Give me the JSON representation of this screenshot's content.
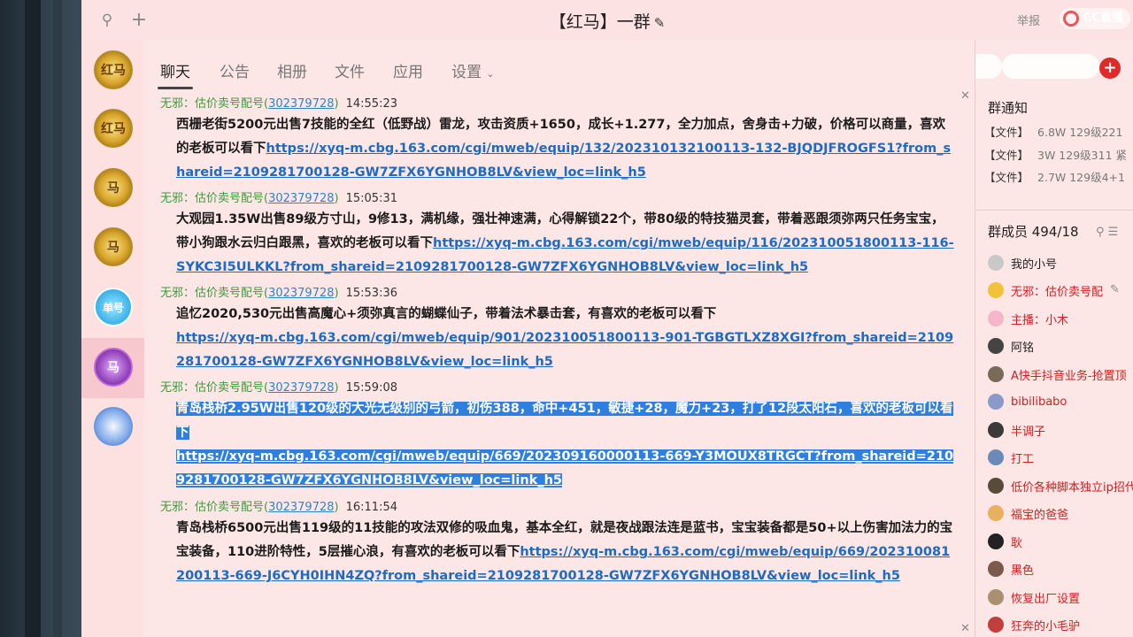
{
  "window": {
    "title": "【红马】一群",
    "report_label": "举报",
    "cc_logo_text": "CC直播"
  },
  "colors": {
    "window_bg": "#fce4e4",
    "link": "#1e6bbf",
    "sender": "#3b9b3b",
    "qq_number": "#2e86c1",
    "selection": "#2f7fe0",
    "member_highlight": "#d02020"
  },
  "sidebar": {
    "avatars": [
      {
        "label": "红马",
        "style": "gold"
      },
      {
        "label": "红马",
        "style": "gold"
      },
      {
        "label": "马",
        "style": "gold"
      },
      {
        "label": "马",
        "style": "gold"
      },
      {
        "label": "单号",
        "style": "blue"
      },
      {
        "label": "马",
        "style": "purple",
        "active": true
      },
      {
        "label": "",
        "style": "char"
      }
    ]
  },
  "tabs": [
    {
      "label": "聊天",
      "active": true
    },
    {
      "label": "公告"
    },
    {
      "label": "相册"
    },
    {
      "label": "文件"
    },
    {
      "label": "应用"
    },
    {
      "label": "设置"
    }
  ],
  "messages": [
    {
      "sender": "无邪：估价卖号配号(",
      "qq": "302379728",
      "sender_end": ")",
      "time": "14:55:23",
      "text": "西栅老街5200元出售7技能的全红（低野战）雷龙，攻击资质+1650，成长+1.277，全力加点，舍身击+力破，价格可以商量，喜欢的老板可以看下",
      "link": "https://xyq-m.cbg.163.com/cgi/mweb/equip/132/20231013210011З-132-BJQDJFROGFS1?from_shareid=2109281700128-GW7ZFX6YGNHOB8LV&view_loc=link_h5"
    },
    {
      "sender": "无邪：估价卖号配号(",
      "qq": "302379728",
      "sender_end": ")",
      "time": "15:05:31",
      "text": "大观园1.35W出售89级方寸山，9修13，满机缘，强壮神速满，心得解锁22个，带80级的特技猫灵套，带着恶跟须弥两只任务宝宝，带小狗跟水云归白跟黑，喜欢的老板可以看下",
      "link": "https://xyq-m.cbg.163.com/cgi/mweb/equip/116/202310051800113-116-SYKC3I5ULKKL?from_shareid=2109281700128-GW7ZFX6YGNHOB8LV&view_loc=link_h5"
    },
    {
      "sender": "无邪：估价卖号配号(",
      "qq": "302379728",
      "sender_end": ")",
      "time": "15:53:36",
      "text": "追忆2020,530元出售高魔心+须弥真言的蝴蝶仙子，带着法术暴击套，有喜欢的老板可以看下",
      "link": "https://xyq-m.cbg.163.com/cgi/mweb/equip/901/202310051800113-901-TGBGTLXZ8XGI?from_shareid=2109281700128-GW7ZFX6YGNHOB8LV&view_loc=link_h5"
    },
    {
      "sender": "无邪：估价卖号配号(",
      "qq": "302379728",
      "sender_end": ")",
      "time": "15:59:08",
      "text": "青岛栈桥2.95W出售120级的大光无级别的弓箭，初伤388，命中+451，敏捷+28，魔力+23，打了12段太阳石，喜欢的老板可以看下",
      "link": "https://xyq-m.cbg.163.com/cgi/mweb/equip/669/202309160000113-669-Y3MOUX8TRGCT?from_shareid=2109281700128-GW7ZFX6YGNHOB8LV&view_loc=link_h5",
      "selected": true
    },
    {
      "sender": "无邪：估价卖号配号(",
      "qq": "302379728",
      "sender_end": ")",
      "time": "16:11:54",
      "text": "青岛栈桥6500元出售119级的11技能的攻法双修的吸血鬼，基本全红，就是夜战跟法连是蓝书，宝宝装备都是50+以上伤害加法力的宝宝装备，110进阶特性，5层摧心浪，有喜欢的老板可以看下",
      "link": "https://xyq-m.cbg.163.com/cgi/mweb/equip/669/202310081200113-669-J6CYH0IHN4ZQ?from_shareid=2109281700128-GW7ZFX6YGNHOB8LV&view_loc=link_h5"
    }
  ],
  "right_panel": {
    "notice_title": "群通知",
    "notices": [
      {
        "tag": "【文件】",
        "value": "6.8W  129级221"
      },
      {
        "tag": "【文件】",
        "value": "3W  129级311  紧"
      },
      {
        "tag": "【文件】",
        "value": "2.7W  129级4+1"
      }
    ],
    "members_title": "群成员 494/18",
    "members": [
      {
        "name": "我的小号",
        "red": false,
        "color": "#c9c9c9"
      },
      {
        "name": "无邪：估价卖号配",
        "red": true,
        "color": "#f3c23a"
      },
      {
        "name": "主播：小木",
        "red": true,
        "color": "#f4b6c8"
      },
      {
        "name": "阿铭",
        "red": false,
        "color": "#444444"
      },
      {
        "name": "A快手抖音业务-抢置顶",
        "red": true,
        "color": "#7a6a5a"
      },
      {
        "name": "bibilibabo",
        "red": true,
        "color": "#8a9ac8"
      },
      {
        "name": "半调子",
        "red": true,
        "color": "#3a3a3a"
      },
      {
        "name": "打工",
        "red": true,
        "color": "#6a8ab8"
      },
      {
        "name": "低价各种脚本独立ip招代理",
        "red": true,
        "color": "#5a4a3a"
      },
      {
        "name": "福宝的爸爸",
        "red": true,
        "color": "#e8b060"
      },
      {
        "name": "耿",
        "red": true,
        "color": "#222222"
      },
      {
        "name": "黑色",
        "red": true,
        "color": "#7a5a4a"
      },
      {
        "name": "恢复出厂设置",
        "red": true,
        "color": "#a89070"
      },
      {
        "name": "狂奔的小毛驴",
        "red": true,
        "color": "#c04040"
      }
    ]
  }
}
